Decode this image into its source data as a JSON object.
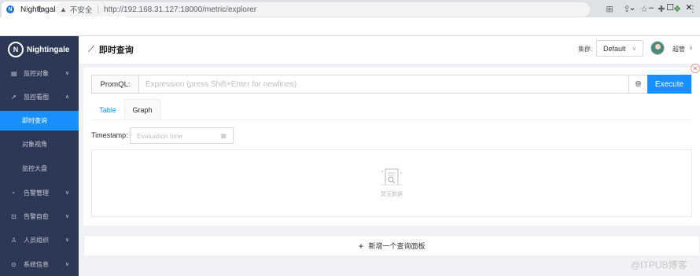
{
  "browser": {
    "tab_title": "Nightingale",
    "tab_close": "×",
    "new_tab": "+",
    "security_label": "不安全",
    "url": "http://192.168.31.127:18000/metric/explorer"
  },
  "sidebar": {
    "logo_text": "Nightingale",
    "items": [
      {
        "label": "监控对象",
        "icon": "server-icon"
      },
      {
        "label": "监控看图",
        "icon": "chart-icon"
      },
      {
        "label": "告警管理",
        "icon": "alarm-icon"
      },
      {
        "label": "告警自愈",
        "icon": "heal-icon"
      },
      {
        "label": "人员组织",
        "icon": "user-icon"
      },
      {
        "label": "系统信息",
        "icon": "info-icon"
      }
    ],
    "subitems": [
      {
        "label": "即时查询",
        "active": true
      },
      {
        "label": "对象视角",
        "active": false
      },
      {
        "label": "监控大盘",
        "active": false
      }
    ]
  },
  "header": {
    "title": "即时查询",
    "cluster_label": "集群:",
    "cluster_value": "Default",
    "username": "超管"
  },
  "query": {
    "promql_label": "PromQL:",
    "placeholder": "Expression (press Shift+Enter for newlines)",
    "execute_label": "Execute",
    "tabs": [
      "Table",
      "Graph"
    ],
    "timestamp_label": "Timestamp:",
    "timestamp_placeholder": "Evaluation time",
    "empty_text": "暂无数据"
  },
  "add_panel_label": "新增一个查询面板",
  "watermark": "@ITPUB博客",
  "colors": {
    "sidebar_bg": "#2c3855",
    "accent": "#1890ff"
  }
}
